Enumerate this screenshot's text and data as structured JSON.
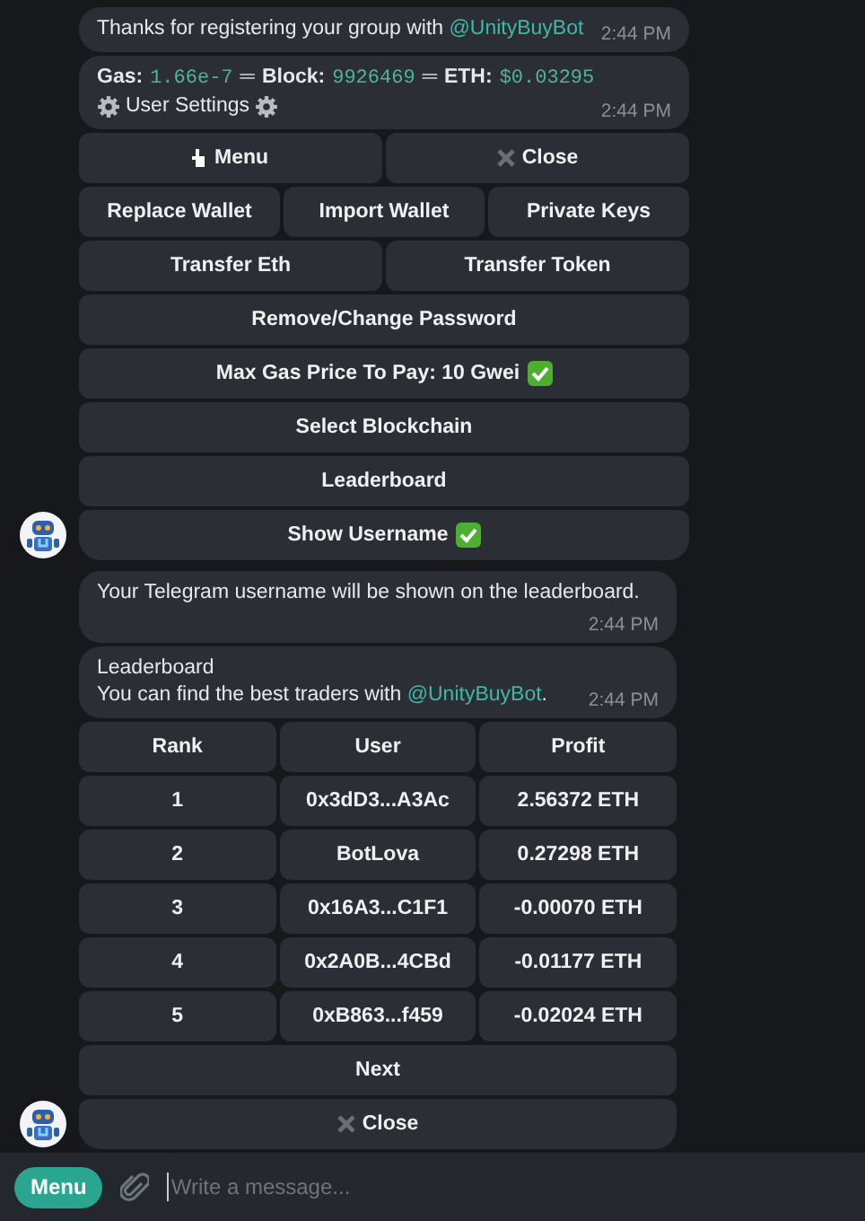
{
  "groups": [
    {
      "messages": [
        {
          "kind": "text",
          "parts": [
            {
              "text": "Thanks for registering your group with ",
              "kind": "text"
            },
            {
              "text": "@UnityBuyBot",
              "kind": "mention"
            }
          ],
          "time": "2:44 PM"
        },
        {
          "kind": "stats",
          "stats": [
            {
              "label": "Gas:",
              "value": "1.66e-7"
            },
            {
              "label": "Block:",
              "value": "9926469"
            },
            {
              "label": "ETH:",
              "value": "$0.03295"
            }
          ],
          "separator": "═",
          "title": "User Settings",
          "time": "2:44 PM",
          "keyboard": [
            [
              {
                "label": "Menu",
                "kind": "pointer"
              },
              {
                "label": "Close",
                "kind": "close"
              }
            ],
            [
              {
                "label": "Replace Wallet",
                "kind": "plain"
              },
              {
                "label": "Import Wallet",
                "kind": "plain"
              },
              {
                "label": "Private Keys",
                "kind": "plain"
              }
            ],
            [
              {
                "label": "Transfer Eth",
                "kind": "plain"
              },
              {
                "label": "Transfer Token",
                "kind": "plain"
              }
            ],
            [
              {
                "label": "Remove/Change Password",
                "kind": "plain"
              }
            ],
            [
              {
                "label": "Max Gas Price To Pay: 10 Gwei",
                "kind": "check"
              }
            ],
            [
              {
                "label": "Select Blockchain",
                "kind": "plain"
              }
            ],
            [
              {
                "label": "Leaderboard",
                "kind": "plain"
              }
            ],
            [
              {
                "label": "Show Username",
                "kind": "check"
              }
            ]
          ]
        }
      ]
    },
    {
      "messages": [
        {
          "kind": "text",
          "parts": [
            {
              "text": "Your Telegram username will be shown on the leaderboard.",
              "kind": "text"
            }
          ],
          "time": "2:44 PM"
        },
        {
          "kind": "leaderboard",
          "title": "Leaderboard",
          "parts": [
            {
              "text": "You can find the best traders with ",
              "kind": "text"
            },
            {
              "text": "@UnityBuyBot",
              "kind": "mention"
            },
            {
              "text": ".",
              "kind": "text"
            }
          ],
          "time": "2:44 PM",
          "table": {
            "columns": [
              "Rank",
              "User",
              "Profit"
            ],
            "rows": [
              [
                "1",
                "0x3dD3...A3Ac",
                "2.56372 ETH"
              ],
              [
                "2",
                "BotLova",
                "0.27298 ETH"
              ],
              [
                "3",
                "0x16A3...C1F1",
                "-0.00070 ETH"
              ],
              [
                "4",
                "0x2A0B...4CBd",
                "-0.01177 ETH"
              ],
              [
                "5",
                "0xB863...f459",
                "-0.02024 ETH"
              ]
            ]
          },
          "keyboard": [
            [
              {
                "label": "Next",
                "kind": "plain"
              }
            ],
            [
              {
                "label": "Close",
                "kind": "close"
              }
            ]
          ]
        }
      ]
    }
  ],
  "composer": {
    "menu_button": "Menu",
    "placeholder": "Write a message..."
  }
}
